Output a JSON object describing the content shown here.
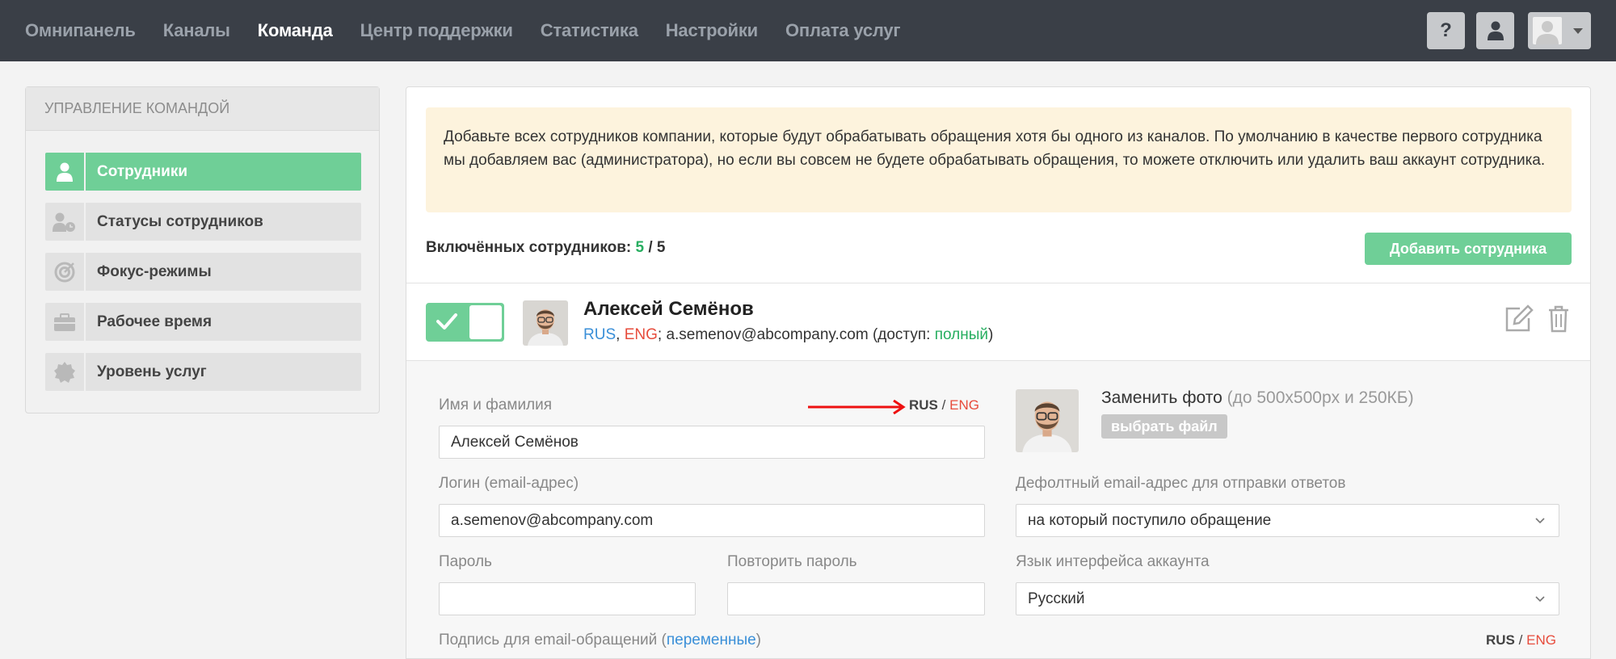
{
  "nav": {
    "items": [
      {
        "label": "Омнипанель",
        "active": false
      },
      {
        "label": "Каналы",
        "active": false
      },
      {
        "label": "Команда",
        "active": true
      },
      {
        "label": "Центр поддержки",
        "active": false
      },
      {
        "label": "Статистика",
        "active": false
      },
      {
        "label": "Настройки",
        "active": false
      },
      {
        "label": "Оплата услуг",
        "active": false
      }
    ],
    "help_label": "?"
  },
  "sidebar": {
    "title": "Управление командой",
    "items": [
      {
        "label": "Сотрудники",
        "icon": "user-icon",
        "active": true
      },
      {
        "label": "Статусы сотрудников",
        "icon": "user-status-icon",
        "active": false
      },
      {
        "label": "Фокус-режимы",
        "icon": "target-icon",
        "active": false
      },
      {
        "label": "Рабочее время",
        "icon": "briefcase-icon",
        "active": false
      },
      {
        "label": "Уровень услуг",
        "icon": "badge-icon",
        "active": false
      }
    ]
  },
  "main": {
    "notice": "Добавьте всех сотрудников компании, которые будут обрабатывать обращения хотя бы одного из каналов. По умолчанию в качестве первого сотрудника мы добавляем вас (администратора), но если вы совсем не будете обрабатывать обращения, то можете отключить или удалить ваш аккаунт сотрудника.",
    "counter_label": "Включённых сотрудников:",
    "counter_enabled": "5",
    "counter_sep": "/",
    "counter_total": "5",
    "add_button": "Добавить сотрудника"
  },
  "employee": {
    "name": "Алексей Семёнов",
    "lang_rus": "RUS",
    "lang_eng": "ENG",
    "email": "a.semenov@abcompany.com",
    "access_prefix": "(доступ:",
    "access_value": "полный",
    "access_suffix": ")"
  },
  "form": {
    "name_label": "Имя и фамилия",
    "name_value": "Алексей Семёнов",
    "lang_rus": "RUS",
    "lang_sep": "/",
    "lang_eng": "ENG",
    "login_label": "Логин (email-адрес)",
    "login_value": "a.semenov@abcompany.com",
    "password_label": "Пароль",
    "password_repeat_label": "Повторить пароль",
    "photo_title": "Заменить фото",
    "photo_hint": "(до 500x500px и 250КБ)",
    "photo_button": "выбрать файл",
    "default_email_label": "Дефолтный email-адрес для отправки ответов",
    "default_email_value": "на который поступило обращение",
    "ui_lang_label": "Язык интерфейса аккаунта",
    "ui_lang_value": "Русский",
    "signature_label": "Подпись для email-обращений (",
    "signature_link": "переменные",
    "signature_suffix": ")"
  },
  "colors": {
    "topbar": "#3a3f47",
    "accent_green": "#6fcf97",
    "notice_bg": "#fdf3dd",
    "lang_rus": "#3a8fd8",
    "lang_eng": "#e74c3c"
  }
}
